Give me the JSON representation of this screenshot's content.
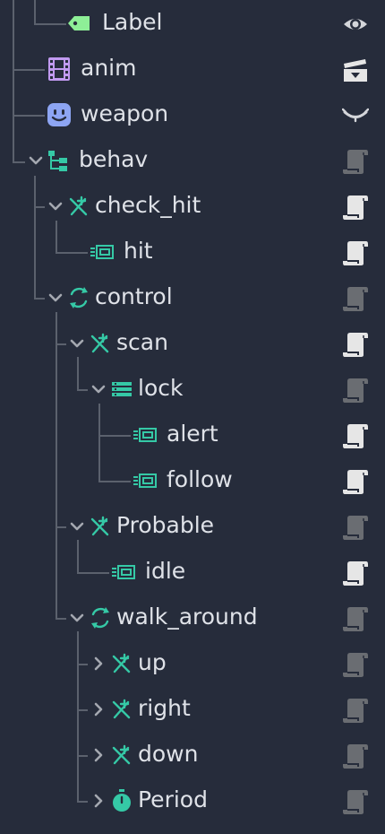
{
  "nodes": [
    {
      "label": "Label",
      "icon": "label-tag-icon",
      "arrow": "none",
      "status": "visibility-eye-icon"
    },
    {
      "label": "anim",
      "icon": "animation-film-icon",
      "arrow": "none",
      "status": "clapperboard-icon"
    },
    {
      "label": "weapon",
      "icon": "face-sprite-icon",
      "arrow": "none",
      "status": "visibility-closed-icon"
    },
    {
      "label": "behav",
      "icon": "tree-hierarchy-icon",
      "arrow": "expanded",
      "status": "script-icon",
      "status_active": false
    },
    {
      "label": "check_hit",
      "icon": "condition-cross-icon",
      "arrow": "expanded",
      "status": "script-icon",
      "status_active": true
    },
    {
      "label": "hit",
      "icon": "action-box-icon",
      "arrow": "none",
      "status": "script-icon",
      "status_active": true
    },
    {
      "label": "control",
      "icon": "loop-refresh-icon",
      "arrow": "expanded",
      "status": "script-icon",
      "status_active": false
    },
    {
      "label": "scan",
      "icon": "condition-cross-icon",
      "arrow": "expanded",
      "status": "script-icon",
      "status_active": true
    },
    {
      "label": "lock",
      "icon": "sequence-list-icon",
      "arrow": "expanded",
      "status": "script-icon",
      "status_active": false
    },
    {
      "label": "alert",
      "icon": "action-box-icon",
      "arrow": "none",
      "status": "script-icon",
      "status_active": true
    },
    {
      "label": "follow",
      "icon": "action-box-icon",
      "arrow": "none",
      "status": "script-icon",
      "status_active": true
    },
    {
      "label": "Probable",
      "icon": "condition-cross-icon",
      "arrow": "expanded",
      "status": "script-icon",
      "status_active": false
    },
    {
      "label": "idle",
      "icon": "action-box-icon",
      "arrow": "none",
      "status": "script-icon",
      "status_active": true
    },
    {
      "label": "walk_around",
      "icon": "loop-refresh-icon",
      "arrow": "expanded",
      "status": "script-icon",
      "status_active": false
    },
    {
      "label": "up",
      "icon": "condition-cross-icon",
      "arrow": "collapsed",
      "status": "script-icon",
      "status_active": false
    },
    {
      "label": "right",
      "icon": "condition-cross-icon",
      "arrow": "collapsed",
      "status": "script-icon",
      "status_active": false
    },
    {
      "label": "down",
      "icon": "condition-cross-icon",
      "arrow": "collapsed",
      "status": "script-icon",
      "status_active": false
    },
    {
      "label": "Period",
      "icon": "timer-stopwatch-icon",
      "arrow": "collapsed",
      "status": "script-icon",
      "status_active": false
    }
  ],
  "colors": {
    "background": "#262c3b",
    "text": "#dfe2e8",
    "guide": "#5b616d",
    "bt_teal": "#35c9a6",
    "label_green": "#8eef97",
    "anim_purple": "#c19af0",
    "sprite_blue": "#8da5f3",
    "script_active": "#e6e6e6",
    "script_inactive": "#6a6d72"
  }
}
